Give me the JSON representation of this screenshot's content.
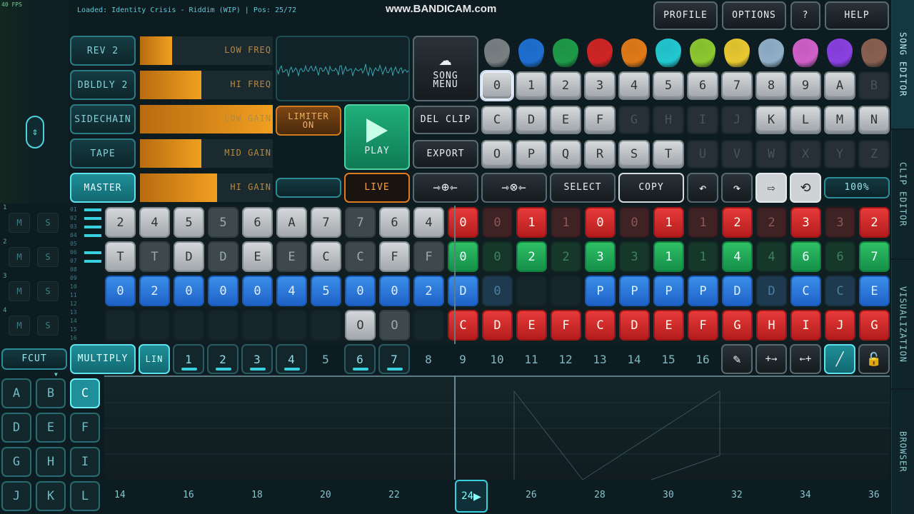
{
  "status_line": "Loaded: Identity Crisis - Riddim (WIP) | Pos: 25/72",
  "fps": "40 FPS",
  "watermark": "www.BANDICAM.com",
  "top_buttons": {
    "profile": "PROFILE",
    "options": "OPTIONS",
    "question": "?",
    "help": "HELP"
  },
  "side_tabs": [
    "SONG EDITOR",
    "CLIP EDITOR",
    "VISUALIZATION",
    "BROWSER"
  ],
  "fx": [
    {
      "label": "REV 2",
      "param": "LOW FREQ",
      "level": 0.24
    },
    {
      "label": "DBLDLY 2",
      "param": "HI FREQ",
      "level": 0.46
    },
    {
      "label": "SIDECHAIN",
      "param": "LOW GAIN",
      "level": 1.0
    },
    {
      "label": "TAPE",
      "param": "MID GAIN",
      "level": 0.46
    },
    {
      "label": "MASTER",
      "param": "HI GAIN",
      "level": 0.58
    }
  ],
  "limiter": "LIMITER ON",
  "play": "PLAY",
  "live": "LIVE",
  "song_menu": "SONG MENU",
  "del_clip": "DEL CLIP",
  "export": "EXPORT",
  "select": "SELECT",
  "copy": "COPY",
  "zoom": "100%",
  "pick_colors": [
    "#7a7f82",
    "#1e6fd0",
    "#1e9a48",
    "#d02424",
    "#e07a18",
    "#22c8d0",
    "#8cc830",
    "#e8c830",
    "#90b0c8",
    "#d060c8",
    "#8a40e0",
    "#8a6050"
  ],
  "keyrows": [
    [
      "0",
      "1",
      "2",
      "3",
      "4",
      "5",
      "6",
      "7",
      "8",
      "9",
      "A",
      "B"
    ],
    [
      "C",
      "D",
      "E",
      "F",
      "G",
      "H",
      "I",
      "J",
      "K",
      "L",
      "M",
      "N"
    ],
    [
      "O",
      "P",
      "Q",
      "R",
      "S",
      "T",
      "U",
      "V",
      "W",
      "X",
      "Y",
      "Z"
    ]
  ],
  "keydim": [
    [
      false,
      false,
      false,
      false,
      false,
      false,
      false,
      false,
      false,
      false,
      false,
      true
    ],
    [
      false,
      false,
      false,
      false,
      true,
      true,
      true,
      true,
      false,
      false,
      false,
      false
    ],
    [
      false,
      false,
      false,
      false,
      false,
      false,
      true,
      true,
      true,
      true,
      true,
      true
    ]
  ],
  "tracks": [
    {
      "num": "1",
      "m": "M",
      "s": "S"
    },
    {
      "num": "2",
      "m": "M",
      "s": "S"
    },
    {
      "num": "3",
      "m": "M",
      "s": "S"
    },
    {
      "num": "4",
      "m": "M",
      "s": "S"
    }
  ],
  "track_meter_labels": [
    "01",
    "02",
    "03",
    "04",
    "05",
    "06",
    "07",
    "08",
    "09",
    "10",
    "11",
    "12",
    "13",
    "14",
    "15",
    "16"
  ],
  "grid": [
    [
      [
        "2",
        "g"
      ],
      [
        "4",
        "g"
      ],
      [
        "5",
        "g"
      ],
      [
        "5",
        "gd"
      ],
      [
        "6",
        "g"
      ],
      [
        "A",
        "g"
      ],
      [
        "7",
        "g"
      ],
      [
        "7",
        "gd"
      ],
      [
        "6",
        "g"
      ],
      [
        "4",
        "g"
      ],
      [
        "0",
        "r"
      ],
      [
        "0",
        "rd"
      ],
      [
        "1",
        "r"
      ],
      [
        "1",
        "rd"
      ],
      [
        "0",
        "r"
      ],
      [
        "0",
        "rd"
      ],
      [
        "1",
        "r"
      ],
      [
        "1",
        "rd"
      ],
      [
        "2",
        "r"
      ],
      [
        "2",
        "rd"
      ],
      [
        "3",
        "r"
      ],
      [
        "3",
        "rd"
      ],
      [
        "2",
        "r"
      ]
    ],
    [
      [
        "T",
        "g"
      ],
      [
        "T",
        "gd"
      ],
      [
        "D",
        "g"
      ],
      [
        "D",
        "gd"
      ],
      [
        "E",
        "g"
      ],
      [
        "E",
        "gd"
      ],
      [
        "C",
        "g"
      ],
      [
        "C",
        "gd"
      ],
      [
        "F",
        "g"
      ],
      [
        "F",
        "gd"
      ],
      [
        "0",
        "gr"
      ],
      [
        "0",
        "grd"
      ],
      [
        "2",
        "gr"
      ],
      [
        "2",
        "grd"
      ],
      [
        "3",
        "gr"
      ],
      [
        "3",
        "grd"
      ],
      [
        "1",
        "gr"
      ],
      [
        "1",
        "grd"
      ],
      [
        "4",
        "gr"
      ],
      [
        "4",
        "grd"
      ],
      [
        "6",
        "gr"
      ],
      [
        "6",
        "grd"
      ],
      [
        "7",
        "gr"
      ]
    ],
    [
      [
        "0",
        "b"
      ],
      [
        "2",
        "b"
      ],
      [
        "0",
        "b"
      ],
      [
        "0",
        "b"
      ],
      [
        "0",
        "b"
      ],
      [
        "4",
        "b"
      ],
      [
        "5",
        "b"
      ],
      [
        "0",
        "b"
      ],
      [
        "0",
        "b"
      ],
      [
        "2",
        "b"
      ],
      [
        "D",
        "b"
      ],
      [
        "0",
        "bd"
      ],
      [
        "",
        "e"
      ],
      [
        "",
        "e"
      ],
      [
        "P",
        "b"
      ],
      [
        "P",
        "b"
      ],
      [
        "P",
        "b"
      ],
      [
        "P",
        "b"
      ],
      [
        "D",
        "b"
      ],
      [
        "D",
        "bd"
      ],
      [
        "C",
        "b"
      ],
      [
        "C",
        "bd"
      ],
      [
        "E",
        "b"
      ]
    ],
    [
      [
        "",
        "e"
      ],
      [
        "",
        "e"
      ],
      [
        "",
        "e"
      ],
      [
        "",
        "e"
      ],
      [
        "",
        "e"
      ],
      [
        "",
        "e"
      ],
      [
        "",
        "e"
      ],
      [
        "O",
        "g"
      ],
      [
        "O",
        "gd"
      ],
      [
        "",
        "e"
      ],
      [
        "C",
        "r"
      ],
      [
        "D",
        "r"
      ],
      [
        "E",
        "r"
      ],
      [
        "F",
        "r"
      ],
      [
        "C",
        "r"
      ],
      [
        "D",
        "r"
      ],
      [
        "E",
        "r"
      ],
      [
        "F",
        "r"
      ],
      [
        "G",
        "r"
      ],
      [
        "H",
        "r"
      ],
      [
        "I",
        "r"
      ],
      [
        "J",
        "r"
      ],
      [
        "G",
        "r"
      ]
    ]
  ],
  "fcut": "FCUT",
  "multiply": "MULTIPLY",
  "lin": "LIN",
  "numbers": [
    "1",
    "2",
    "3",
    "4",
    "5",
    "6",
    "7",
    "8",
    "9",
    "10",
    "11",
    "12",
    "13",
    "14",
    "15",
    "16"
  ],
  "numbers_on": [
    true,
    true,
    true,
    true,
    false,
    true,
    true,
    false,
    false,
    false,
    false,
    false,
    false,
    false,
    false,
    false
  ],
  "letter_keys": [
    "A",
    "B",
    "C",
    "D",
    "E",
    "F",
    "G",
    "H",
    "I",
    "J",
    "K",
    "L"
  ],
  "letter_selected": "C",
  "ruler": [
    "14",
    "16",
    "18",
    "20",
    "22",
    "24",
    "26",
    "28",
    "30",
    "32",
    "34",
    "36"
  ],
  "playhead_label": "24"
}
